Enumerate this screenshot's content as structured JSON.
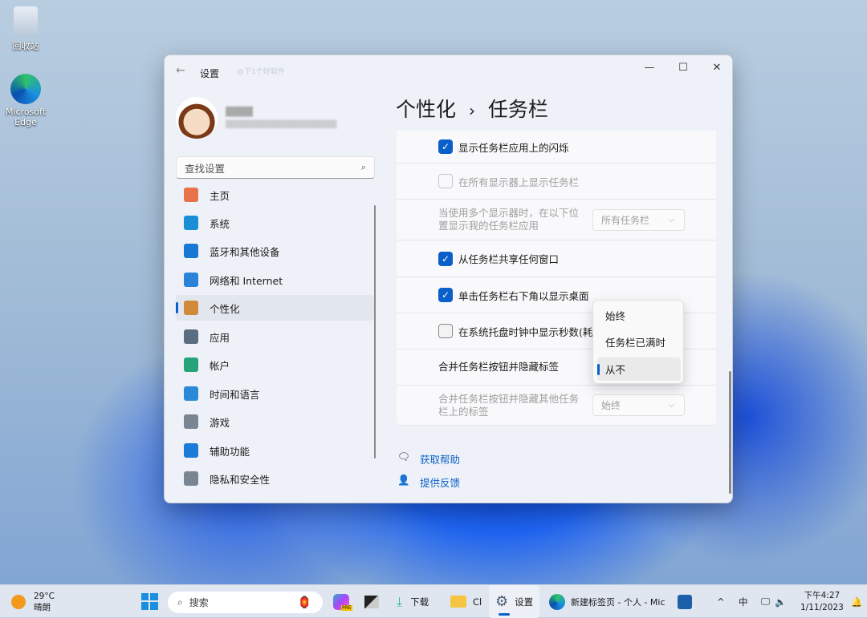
{
  "desktop": {
    "icons": [
      {
        "label": "回收站"
      },
      {
        "label": "Microsoft Edge"
      }
    ]
  },
  "window": {
    "title": "设置",
    "watermark": "@下1个好软件",
    "controls": {
      "minimize": "—",
      "maximize": "☐",
      "close": "✕"
    },
    "user": {
      "name": "▓▓▓▓",
      "email": "▒▒▒▒▒▒▒▒▒▒▒▒▒▒▒▒▒▒▒▒"
    },
    "search": {
      "placeholder": "查找设置"
    },
    "nav": [
      {
        "label": "主页",
        "icon": "home-icon",
        "color": "#e8734a"
      },
      {
        "label": "系统",
        "icon": "system-icon",
        "color": "#1a8fd8"
      },
      {
        "label": "蓝牙和其他设备",
        "icon": "bluetooth-icon",
        "color": "#1878d6"
      },
      {
        "label": "网络和 Internet",
        "icon": "wifi-icon",
        "color": "#2a83d8"
      },
      {
        "label": "个性化",
        "icon": "brush-icon",
        "color": "#d08a3a",
        "selected": true
      },
      {
        "label": "应用",
        "icon": "apps-icon",
        "color": "#5a6c80"
      },
      {
        "label": "帐户",
        "icon": "account-icon",
        "color": "#27a37a"
      },
      {
        "label": "时间和语言",
        "icon": "clock-globe-icon",
        "color": "#2a8ad8"
      },
      {
        "label": "游戏",
        "icon": "gamepad-icon",
        "color": "#7a8594"
      },
      {
        "label": "辅助功能",
        "icon": "accessibility-icon",
        "color": "#1a7bd8"
      },
      {
        "label": "隐私和安全性",
        "icon": "shield-icon",
        "color": "#7a8594"
      }
    ],
    "breadcrumb": {
      "parent": "个性化",
      "separator": "›",
      "current": "任务栏"
    },
    "settings": [
      {
        "label": "显示任务栏应用上的闪烁",
        "type": "checkbox",
        "checked": true,
        "disabled": false
      },
      {
        "label": "在所有显示器上显示任务栏",
        "type": "checkbox",
        "checked": false,
        "disabled": true
      },
      {
        "label": "当使用多个显示器时，在以下位置显示我的任务栏应用",
        "type": "dropdown",
        "value": "所有任务栏",
        "disabled": true
      },
      {
        "label": "从任务栏共享任何窗口",
        "type": "checkbox",
        "checked": true,
        "disabled": false
      },
      {
        "label": "单击任务栏右下角以显示桌面",
        "type": "checkbox",
        "checked": true,
        "disabled": false
      },
      {
        "label": "在系统托盘时钟中显示秒数(耗电",
        "type": "checkbox",
        "checked": false,
        "disabled": false
      },
      {
        "label": "合并任务栏按钮并隐藏标签",
        "type": "dropdown-open",
        "disabled": false
      },
      {
        "label": "合并任务栏按钮并隐藏其他任务栏上的标签",
        "type": "dropdown",
        "value": "始终",
        "disabled": true
      }
    ],
    "popup": {
      "options": [
        "始终",
        "任务栏已满时",
        "从不"
      ],
      "selected": "从不"
    },
    "links": [
      {
        "label": "获取帮助"
      },
      {
        "label": "提供反馈"
      }
    ]
  },
  "accent": "#0a5fc8",
  "taskbar": {
    "weather": {
      "temp": "29°C",
      "condition": "晴朗"
    },
    "search_placeholder": "搜索",
    "badge": "PRE",
    "apps": [
      {
        "label": "下载"
      },
      {
        "label": "Cl"
      },
      {
        "label": "设置"
      },
      {
        "label": "新建标签页 - 个人 - Mic"
      }
    ],
    "tray": {
      "chevron": "^",
      "ime": "中",
      "time": "下午4:27",
      "date": "1/11/2023"
    }
  }
}
